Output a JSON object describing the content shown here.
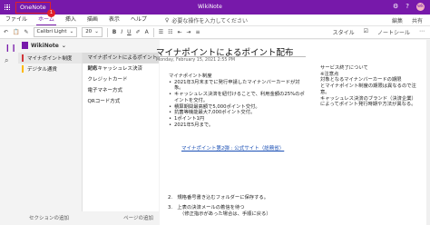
{
  "titlebar": {
    "app_name": "OneNote",
    "window_title": "WikiNote",
    "avatar": "wk"
  },
  "menubar": {
    "items": [
      "ファイル",
      "ホーム",
      "挿入",
      "描画",
      "表示",
      "ヘルプ"
    ],
    "active_index": 1,
    "tell_me": "必要な操作を入力してください",
    "right": [
      "編集",
      "共有"
    ],
    "badge": "1"
  },
  "ribbon": {
    "font_name": "Calibri Light",
    "font_size": "20",
    "right_items": [
      "スタイル",
      "ノートシール"
    ]
  },
  "notebook": {
    "name": "WikiNote",
    "sections": [
      {
        "label": "マイナポイント制度",
        "color": "#d13438"
      },
      {
        "label": "デジタル通貨",
        "color": "#ffb900"
      }
    ],
    "pages": [
      "マイナポイントによるポイント配布",
      "対応キャッシュレス決済",
      "クレジットカード",
      "電子マネー方式",
      "QRコード方式"
    ],
    "selected_page": 0,
    "add_section": "セクションの追加",
    "add_page": "ページの追加"
  },
  "page": {
    "title": "マイナポイントによるポイント配布",
    "date": "Monday, February 15, 2021     2:55 PM",
    "heading": "マイナポイント制度",
    "bullets": [
      "2021年3月末までに発行申請したマイナンバーカードが対象。",
      "キャッシュレス決済を紐付けることで、利用金額の25%のポイントを交付。",
      "積算期間最高額で5,000ポイント交付。",
      "抗菌等機能最大7,000ポイント交付。",
      "1ポイント1円",
      "2021年5月まで。"
    ],
    "side_note": [
      "サービス終了について",
      "※注意点",
      "対象となるマイナンバーカードの期限",
      "とマイナポイント制度の期限は異なるので注意。",
      "キャッシュレス決済のブランド（決済企業）によってポイント発行時期や方法が異なる。"
    ],
    "link_text": "マイナポイント第2弾 : 公式サイト（総務省）",
    "numbered": [
      "2.　規格番号書き込むフォルダーに保存する。",
      "3.　上表の決済メールの着信を待つ",
      "（修正指示があった場合は、手順に戻る）"
    ]
  }
}
